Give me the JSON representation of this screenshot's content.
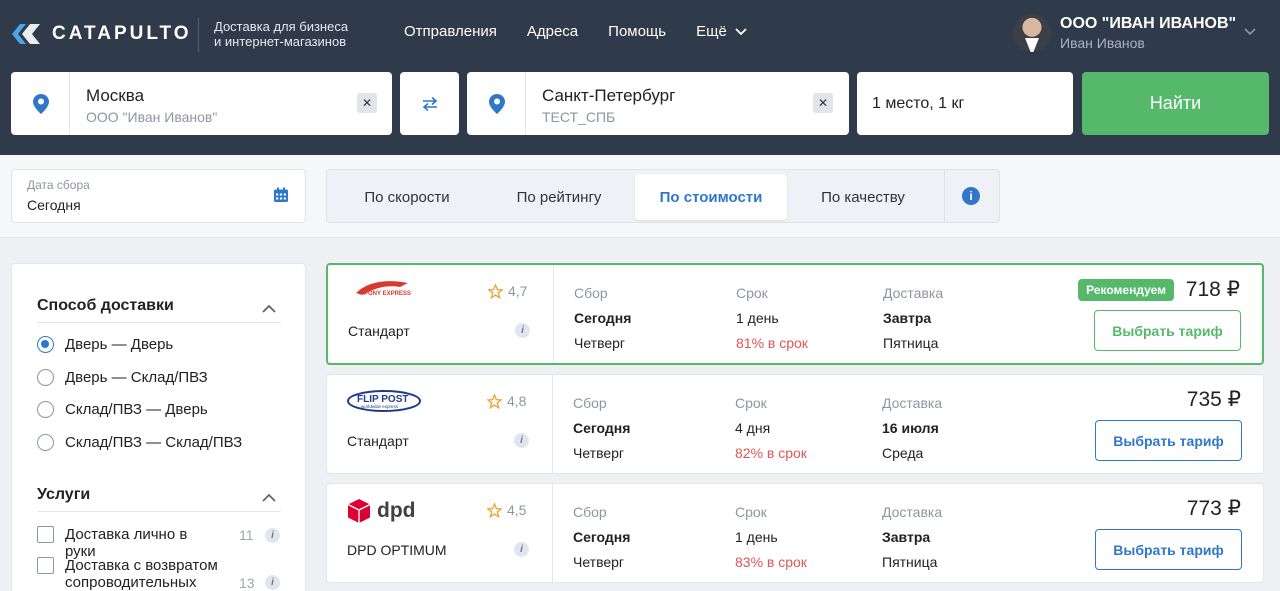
{
  "header": {
    "logo": "CATAPULTO",
    "tagline_1": "Доставка для бизнеса",
    "tagline_2": "и интернет-магазинов",
    "nav": [
      "Отправления",
      "Адреса",
      "Помощь",
      "Ещё"
    ],
    "company": "ООО \"ИВАН ИВАНОВ\"",
    "user": "Иван Иванов"
  },
  "search": {
    "from_city": "Москва",
    "from_sub": "ООО \"Иван Иванов\"",
    "to_city": "Санкт-Петербург",
    "to_sub": "ТЕСТ_СПБ",
    "places": "1 место, 1 кг",
    "find_label": "Найти"
  },
  "toolbar": {
    "date_label": "Дата сбора",
    "date_value": "Сегодня",
    "sort_tabs": [
      "По скорости",
      "По рейтингу",
      "По стоимости",
      "По качеству"
    ],
    "active_tab": "По стоимости"
  },
  "filters": {
    "delivery_title": "Способ доставки",
    "delivery_options": [
      "Дверь — Дверь",
      "Дверь — Склад/ПВЗ",
      "Склад/ПВЗ — Дверь",
      "Склад/ПВЗ — Склад/ПВЗ"
    ],
    "services_title": "Услуги",
    "services": [
      {
        "label": "Доставка лично в руки",
        "count": "11"
      },
      {
        "label": "Доставка с возвратом сопроводительных",
        "count": "13"
      }
    ]
  },
  "labels": {
    "pickup": "Сбор",
    "term": "Срок",
    "delivery": "Доставка",
    "choose": "Выбрать тариф",
    "recommended": "Рекомендуем"
  },
  "offers": [
    {
      "carrier_logo": "PONY EXPRESS",
      "rating": "4,7",
      "tariff": "Стандарт",
      "pickup_day": "Сегодня",
      "pickup_weekday": "Четверг",
      "term": "1 день",
      "on_time": "81% в срок",
      "delivery_day": "Завтра",
      "delivery_weekday": "Пятница",
      "price": "718 ₽",
      "recommended": true
    },
    {
      "carrier_logo": "FLIP POST",
      "carrier_logo_sub": "worldwide express",
      "rating": "4,8",
      "tariff": "Стандарт",
      "pickup_day": "Сегодня",
      "pickup_weekday": "Четверг",
      "term": "4 дня",
      "on_time": "82% в срок",
      "delivery_day": "16 июля",
      "delivery_weekday": "Среда",
      "price": "735 ₽",
      "recommended": false
    },
    {
      "carrier_logo": "dpd",
      "rating": "4,5",
      "tariff": "DPD OPTIMUM",
      "pickup_day": "Сегодня",
      "pickup_weekday": "Четверг",
      "term": "1 день",
      "on_time": "83% в срок",
      "delivery_day": "Завтра",
      "delivery_weekday": "Пятница",
      "price": "773 ₽",
      "recommended": false
    }
  ],
  "colors": {
    "header_bg": "#2f3a4a",
    "accent_green": "#55b86b",
    "accent_blue": "#2f77c9",
    "warning_red": "#e05555"
  },
  "icons": [
    "logo-icon",
    "chevron-down-icon",
    "location-pin-icon",
    "close-icon",
    "swap-icon",
    "calendar-icon",
    "info-icon",
    "star-icon",
    "dpd-cube-icon"
  ]
}
